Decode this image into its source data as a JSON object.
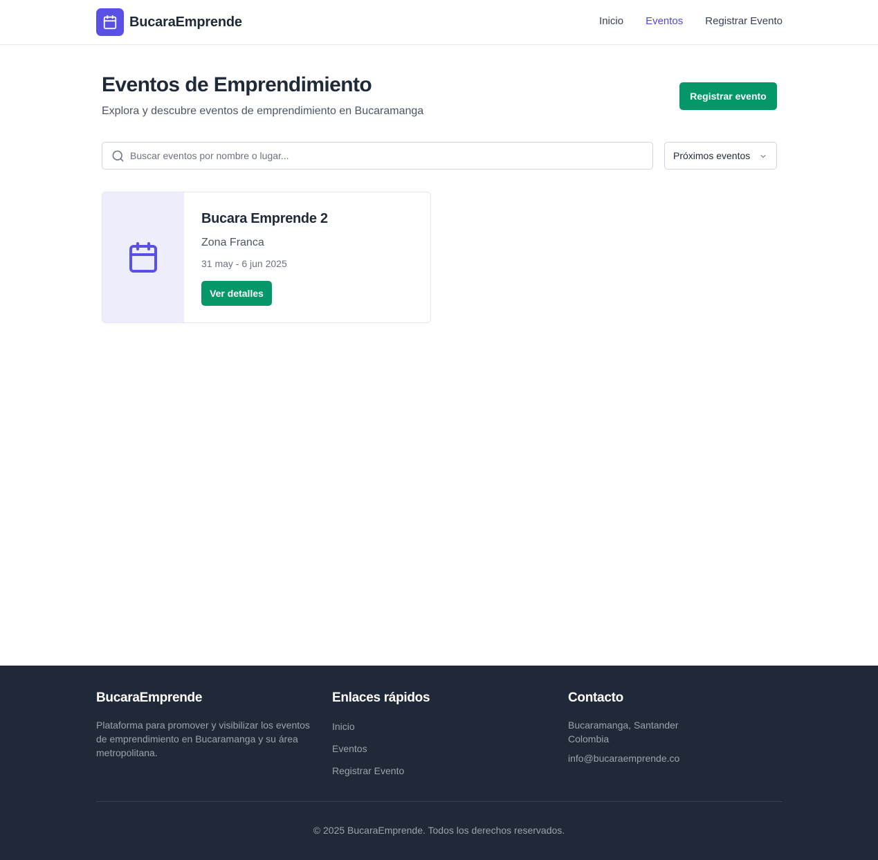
{
  "header": {
    "brand": "BucaraEmprende",
    "nav": [
      {
        "label": "Inicio",
        "active": false
      },
      {
        "label": "Eventos",
        "active": true
      },
      {
        "label": "Registrar Evento",
        "active": false
      }
    ]
  },
  "main": {
    "title": "Eventos de Emprendimiento",
    "subtitle": "Explora y descubre eventos de emprendimiento en Bucaramanga",
    "register_button": "Registrar evento",
    "search": {
      "placeholder": "Buscar eventos por nombre o lugar...",
      "value": ""
    },
    "filter": {
      "selected": "Próximos eventos"
    },
    "events": [
      {
        "title": "Bucara Emprende 2",
        "location": "Zona Franca",
        "date": "31 may - 6 jun 2025",
        "button": "Ver detalles"
      }
    ]
  },
  "footer": {
    "about": {
      "title": "BucaraEmprende",
      "description": "Plataforma para promover y visibilizar los eventos de emprendimiento en Bucaramanga y su área metropolitana."
    },
    "links": {
      "title": "Enlaces rápidos",
      "items": [
        "Inicio",
        "Eventos",
        "Registrar Evento"
      ]
    },
    "contact": {
      "title": "Contacto",
      "address_line1": "Bucaramanga, Santander",
      "address_line2": "Colombia",
      "email": "info@bucaraemprende.co"
    },
    "copyright": "© 2025 BucaraEmprende. Todos los derechos reservados."
  },
  "colors": {
    "brand": "#5b50e6",
    "accent_active": "#4f46e5",
    "primary_button": "#059669",
    "footer_bg": "#1f2937"
  },
  "icons": [
    "calendar-icon",
    "search-icon",
    "chevron-down-icon"
  ]
}
